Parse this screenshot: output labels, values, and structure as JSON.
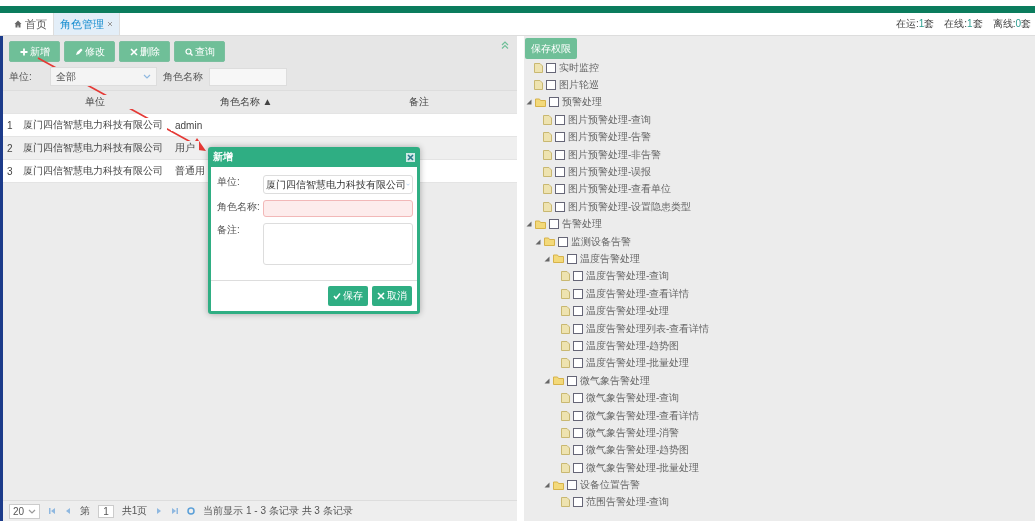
{
  "tabs": [
    {
      "label": "首页",
      "selected": false,
      "closable": false
    },
    {
      "label": "角色管理",
      "selected": true,
      "closable": true
    }
  ],
  "status": [
    {
      "label": "在运:",
      "value": "1",
      "unit": "套"
    },
    {
      "label": "在线:",
      "value": "1",
      "unit": "套"
    },
    {
      "label": "离线:",
      "value": "0",
      "unit": "套"
    }
  ],
  "toolbar": [
    {
      "kind": "add",
      "label": "新增"
    },
    {
      "kind": "edit",
      "label": "修改"
    },
    {
      "kind": "delete",
      "label": "删除"
    },
    {
      "kind": "search",
      "label": "查询"
    }
  ],
  "filters": {
    "unit_label": "单位:",
    "unit_value": "全部",
    "role_label": "角色名称"
  },
  "table": {
    "columns": [
      "单位",
      "角色名称 ▲",
      "备注"
    ],
    "rows": [
      {
        "index": "1",
        "unit": "厦门四信智慧电力科技有限公司",
        "role": "admin",
        "selected": false
      },
      {
        "index": "2",
        "unit": "厦门四信智慧电力科技有限公司",
        "role": "用户",
        "selected": true
      },
      {
        "index": "3",
        "unit": "厦门四信智慧电力科技有限公司",
        "role": "普通用",
        "selected": false
      }
    ]
  },
  "pager": {
    "page_size": "20",
    "page_label": "第",
    "page": "1",
    "total_pages": "共1页",
    "summary": "当前显示 1 - 3 条记录 共 3 条记录"
  },
  "dialog": {
    "title": "新增",
    "unit_label": "单位:",
    "unit_value": "厦门四信智慧电力科技有限公司",
    "role_label": "角色名称:",
    "role_invalid": true,
    "note_label": "备注:",
    "save": "保存",
    "cancel": "取消"
  },
  "save_permissions": "保存权限",
  "tree": [
    {
      "kind": "file",
      "label": "实时监控",
      "checked": false
    },
    {
      "kind": "file",
      "label": "图片轮巡",
      "checked": false
    },
    {
      "kind": "folder",
      "label": "预警处理",
      "checked": false,
      "expanded": true,
      "children": [
        {
          "kind": "file",
          "label": "图片预警处理-查询",
          "checked": false
        },
        {
          "kind": "file",
          "label": "图片预警处理-告警",
          "checked": false
        },
        {
          "kind": "file",
          "label": "图片预警处理-非告警",
          "checked": false
        },
        {
          "kind": "file",
          "label": "图片预警处理-误报",
          "checked": false
        },
        {
          "kind": "file",
          "label": "图片预警处理-查看单位",
          "checked": false
        },
        {
          "kind": "file",
          "label": "图片预警处理-设置隐患类型",
          "checked": false
        }
      ]
    },
    {
      "kind": "folder",
      "label": "告警处理",
      "checked": false,
      "expanded": true,
      "children": [
        {
          "kind": "folder",
          "label": "监测设备告警",
          "checked": false,
          "expanded": true,
          "children": [
            {
              "kind": "folder",
              "label": "温度告警处理",
              "checked": false,
              "expanded": true,
              "children": [
                {
                  "kind": "file",
                  "label": "温度告警处理-查询",
                  "checked": false
                },
                {
                  "kind": "file",
                  "label": "温度告警处理-查看详情",
                  "checked": false
                },
                {
                  "kind": "file",
                  "label": "温度告警处理-处理",
                  "checked": false
                },
                {
                  "kind": "file",
                  "label": "温度告警处理列表-查看详情",
                  "checked": false
                },
                {
                  "kind": "file",
                  "label": "温度告警处理-趋势图",
                  "checked": false
                },
                {
                  "kind": "file",
                  "label": "温度告警处理-批量处理",
                  "checked": false
                }
              ]
            },
            {
              "kind": "folder",
              "label": "微气象告警处理",
              "checked": false,
              "expanded": true,
              "children": [
                {
                  "kind": "file",
                  "label": "微气象告警处理-查询",
                  "checked": false
                },
                {
                  "kind": "file",
                  "label": "微气象告警处理-查看详情",
                  "checked": false
                },
                {
                  "kind": "file",
                  "label": "微气象告警处理-消警",
                  "checked": false
                },
                {
                  "kind": "file",
                  "label": "微气象告警处理-趋势图",
                  "checked": false
                },
                {
                  "kind": "file",
                  "label": "微气象告警处理-批量处理",
                  "checked": false
                }
              ]
            },
            {
              "kind": "folder",
              "label": "设备位置告警",
              "checked": false,
              "expanded": true,
              "children": [
                {
                  "kind": "file",
                  "label": "范围告警处理-查询",
                  "checked": false
                }
              ]
            }
          ]
        }
      ]
    }
  ]
}
